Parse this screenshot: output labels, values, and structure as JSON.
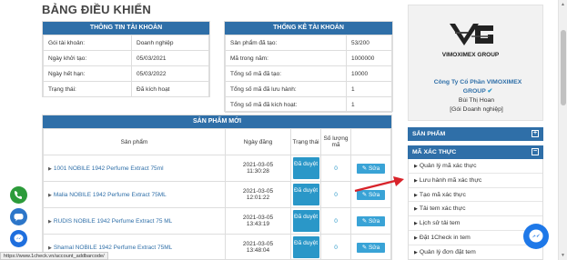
{
  "page_title": "BẢNG ĐIỀU KHIỂN",
  "account_info": {
    "heading": "THÔNG TIN TÀI KHOẢN",
    "rows": [
      {
        "label": "Gói tài khoản:",
        "value": "Doanh nghiệp"
      },
      {
        "label": "Ngày khởi tạo:",
        "value": "05/03/2021"
      },
      {
        "label": "Ngày hết hạn:",
        "value": "05/03/2022"
      },
      {
        "label": "Trạng thái:",
        "value": "Đã kích hoạt"
      }
    ]
  },
  "account_stats": {
    "heading": "THỐNG KÊ TÀI KHOẢN",
    "rows": [
      {
        "label": "Sản phẩm đã tạo:",
        "value": "53/200"
      },
      {
        "label": "Mã trong năm:",
        "value": "1000000"
      },
      {
        "label": "Tổng số mã đã tạo:",
        "value": "10000"
      },
      {
        "label": "Tổng số mã đã lưu hành:",
        "value": "1"
      },
      {
        "label": "Tổng số mã đã kích hoạt:",
        "value": "1"
      }
    ]
  },
  "new_products": {
    "heading": "SẢN PHẨM MỚI",
    "columns": [
      "Sản phẩm",
      "Ngày đăng",
      "Trạng thái",
      "Số lượng mã",
      ""
    ],
    "rows": [
      {
        "name": "1001 NOBILE 1942 Perfume Extract 75ml",
        "date": "2021-03-05",
        "time": "11:30:28",
        "status": "Đã duyệt",
        "qty": "0",
        "action": "Sửa"
      },
      {
        "name": "Malia NOBILE 1942 Perfume Extract 75ML",
        "date": "2021-03-05",
        "time": "12:01:22",
        "status": "Đã duyệt",
        "qty": "0",
        "action": "Sửa"
      },
      {
        "name": "RUDIS NOBILE 1942 Perfume Extract 75 ML",
        "date": "2021-03-05",
        "time": "13:43:19",
        "status": "Đã duyệt",
        "qty": "0",
        "action": "Sửa"
      },
      {
        "name": "Shamal NOBILE 1942 Perfume Extract 75ML",
        "date": "2021-03-05",
        "time": "13:48:04",
        "status": "Đã duyệt",
        "qty": "0",
        "action": "Sửa"
      }
    ]
  },
  "company": {
    "logo_text": "VIMOXIMEX GROUP",
    "name_line1": "Công Ty Cổ Phần VIMOXIMEX",
    "name_line2": "GROUP",
    "person": "Bùi Thị Hoan",
    "package": "[Gói Doanh nghiệp]"
  },
  "sidebar": {
    "products_label": "SẢN PHẨM",
    "products_toggle": "+",
    "codes_label": "MÃ XÁC THỰC",
    "codes_toggle": "−",
    "items": [
      "Quản lý mã xác thực",
      "Lưu hành mã xác thực",
      "Tạo mã xác thực",
      "Tải tem xác thực",
      "Lịch sử tải tem",
      "Đặt 1Check in tem",
      "Quản lý đơn đặt tem"
    ]
  },
  "status_url": "https://www.1check.vn/account_addbarcode/",
  "colors": {
    "header_blue": "#2f6fa8",
    "button_blue": "#2a97c8",
    "arrow_red": "#d8232a"
  },
  "icons": [
    "phone-icon",
    "zalo-chat-icon",
    "messenger-icon",
    "messenger-fab-icon",
    "pencil-icon"
  ]
}
